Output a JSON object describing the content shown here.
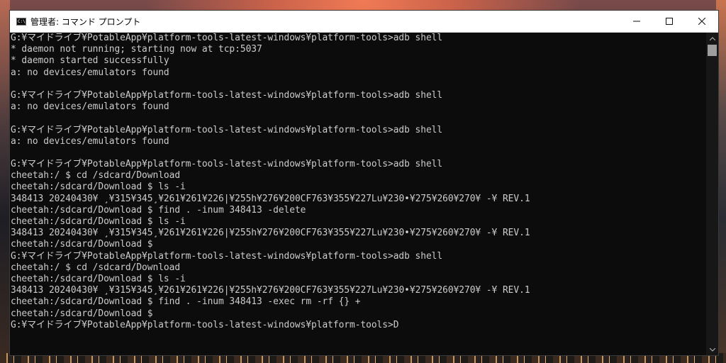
{
  "window": {
    "title": "管理者: コマンド プロンプト",
    "icon": "console-icon",
    "icon_glyph": "C:\\",
    "controls": {
      "minimize": "minimize-icon",
      "maximize": "maximize-icon",
      "close": "close-icon"
    }
  },
  "console": {
    "lines": [
      "G:¥マイドライブ¥PotableApp¥platform-tools-latest-windows¥platform-tools>adb shell",
      "* daemon not running; starting now at tcp:5037",
      "* daemon started successfully",
      "a: no devices/emulators found",
      "",
      "G:¥マイドライブ¥PotableApp¥platform-tools-latest-windows¥platform-tools>adb shell",
      "a: no devices/emulators found",
      "",
      "G:¥マイドライブ¥PotableApp¥platform-tools-latest-windows¥platform-tools>adb shell",
      "a: no devices/emulators found",
      "",
      "G:¥マイドライブ¥PotableApp¥platform-tools-latest-windows¥platform-tools>adb shell",
      "cheetah:/ $ cd /sdcard/Download",
      "cheetah:/sdcard/Download $ ls -i",
      "348413 20240430¥ ¸¥315¥345¸¥261¥261¥226|¥255h¥276¥200CF763¥355¥227Lu¥230•¥275¥260¥270¥ -¥ REV.1",
      "cheetah:/sdcard/Download $ find . -inum 348413 -delete",
      "cheetah:/sdcard/Download $ ls -i",
      "348413 20240430¥ ¸¥315¥345¸¥261¥261¥226|¥255h¥276¥200CF763¥355¥227Lu¥230•¥275¥260¥270¥ -¥ REV.1",
      "cheetah:/sdcard/Download $",
      "G:¥マイドライブ¥PotableApp¥platform-tools-latest-windows¥platform-tools>adb shell",
      "cheetah:/ $ cd /sdcard/Download",
      "cheetah:/sdcard/Download $ ls -i",
      "348413 20240430¥ ¸¥315¥345¸¥261¥261¥226|¥255h¥276¥200CF763¥355¥227Lu¥230•¥275¥260¥270¥ -¥ REV.1",
      "cheetah:/sdcard/Download $ find . -inum 348413 -exec rm -rf {} +",
      "cheetah:/sdcard/Download $",
      "G:¥マイドライブ¥PotableApp¥platform-tools-latest-windows¥platform-tools>D"
    ]
  },
  "colors": {
    "console_bg": "#0c0c0c",
    "console_text": "#cccccc",
    "titlebar_bg": "#ffffff",
    "scrollbar_thumb": "#9e9e9e"
  }
}
